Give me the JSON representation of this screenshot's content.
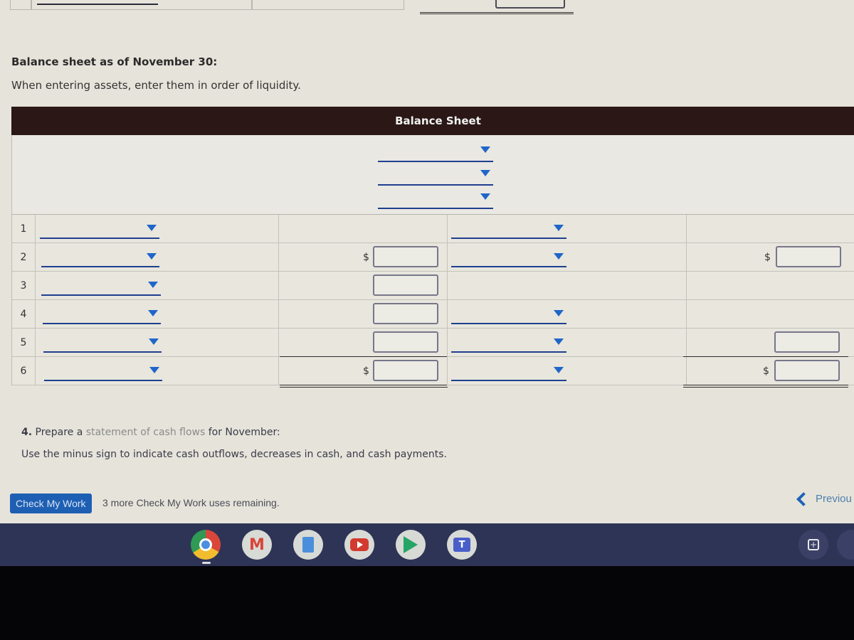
{
  "section": {
    "title": "Balance sheet as of November 30:",
    "note": "When entering assets, enter them in order of liquidity."
  },
  "balance_sheet": {
    "header": "Balance Sheet",
    "header_selects": [
      {
        "value": ""
      },
      {
        "value": ""
      },
      {
        "value": ""
      }
    ],
    "rows": [
      {
        "num": "1",
        "left_account": "",
        "left_dollar": "",
        "left_amount": null,
        "right_account": "",
        "right_dollar": "",
        "right_amount": null
      },
      {
        "num": "2",
        "left_account": "",
        "left_dollar": "$",
        "left_amount": "",
        "right_account": "",
        "right_dollar": "$",
        "right_amount": ""
      },
      {
        "num": "3",
        "left_account": "",
        "left_dollar": "",
        "left_amount": "",
        "right_account": null,
        "right_dollar": "",
        "right_amount": null
      },
      {
        "num": "4",
        "left_account": "",
        "left_dollar": "",
        "left_amount": "",
        "right_account": "",
        "right_dollar": "",
        "right_amount": null
      },
      {
        "num": "5",
        "left_account": "",
        "left_dollar": "",
        "left_amount": "",
        "right_account": "",
        "right_dollar": "",
        "right_amount": ""
      },
      {
        "num": "6",
        "left_account": "",
        "left_dollar": "$",
        "left_amount": "",
        "right_account": "",
        "right_dollar": "$",
        "right_amount": ""
      }
    ]
  },
  "question4": {
    "number": "4.",
    "prefix": " Prepare a ",
    "link": "statement of cash flows",
    "suffix": " for November:",
    "note": "Use the minus sign to indicate cash outflows, decreases in cash, and cash payments."
  },
  "footer": {
    "check_button": "Check My Work",
    "check_note": "3 more Check My Work uses remaining.",
    "previous": "Previou"
  },
  "shelf": {
    "apps": [
      {
        "name": "chrome-icon",
        "label": ""
      },
      {
        "name": "gmail-icon",
        "label": "M"
      },
      {
        "name": "docs-icon",
        "label": ""
      },
      {
        "name": "youtube-icon",
        "label": ""
      },
      {
        "name": "play-store-icon",
        "label": ""
      },
      {
        "name": "teams-icon",
        "label": "T"
      }
    ],
    "tray_icon_label": "+"
  }
}
